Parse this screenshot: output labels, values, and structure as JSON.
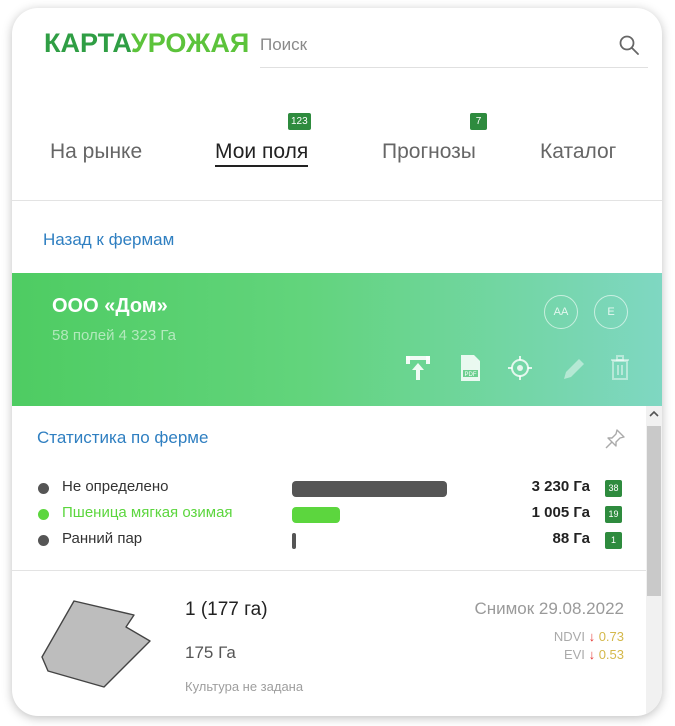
{
  "header": {
    "logo_part1": "КАРТА",
    "logo_part2": "УРОЖАЯ",
    "search_placeholder": "Поиск"
  },
  "tabs": [
    {
      "label": "На рынке"
    },
    {
      "label": "Мои поля",
      "badge": "123",
      "active": true
    },
    {
      "label": "Прогнозы",
      "badge": "7"
    },
    {
      "label": "Каталог"
    }
  ],
  "back_link": "Назад к фермам",
  "farm": {
    "name": "ООО «Дом»",
    "meta": "58 полей 4 323 Га",
    "avatars": [
      "АА",
      "Е"
    ]
  },
  "stats": {
    "title": "Статистика по ферме",
    "rows": [
      {
        "label": "Не определено",
        "value": "3 230 Га",
        "count": "38",
        "color": "#555555",
        "bar_fraction": 1.0
      },
      {
        "label": "Пшеница мягкая озимая",
        "value": "1 005 Га",
        "count": "19",
        "color": "#5cd63e",
        "bar_fraction": 0.31
      },
      {
        "label": "Ранний пар",
        "value": "88 Га",
        "count": "1",
        "color": "#555555",
        "bar_fraction": 0.027
      }
    ]
  },
  "field": {
    "title": "1 (177 га)",
    "area": "175 Га",
    "crop": "Культура не задана",
    "snapshot": "Снимок 29.08.2022",
    "ndvi_label": "NDVI",
    "ndvi_arrow": "↓",
    "ndvi_value": "0.73",
    "evi_label": "EVI",
    "evi_arrow": "↓",
    "evi_value": "0.53"
  },
  "colors": {
    "brand_dark": "#2f9e44",
    "brand_light": "#5cc33b",
    "link": "#2f7fc1",
    "badge": "#2e8b3e"
  },
  "icons": [
    "search-icon",
    "upload-icon",
    "pdf-icon",
    "locate-icon",
    "edit-icon",
    "trash-icon",
    "pin-icon",
    "chevron-up-icon"
  ]
}
